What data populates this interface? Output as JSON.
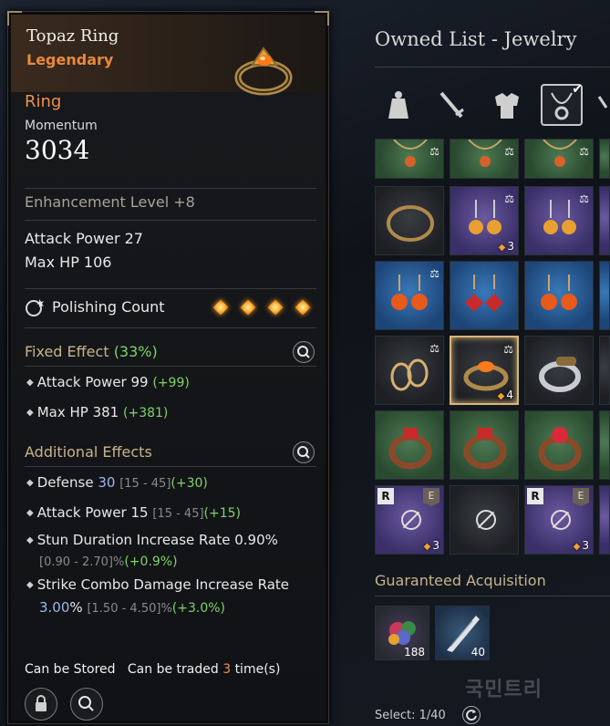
{
  "tooltip": {
    "item_name": "Topaz Ring",
    "grade": "Legendary",
    "type": "Ring",
    "momentum_label": "Momentum",
    "momentum_value": "3034",
    "enhancement": "Enhancement Level +8",
    "base_stats": [
      "Attack Power 27",
      "Max HP 106"
    ],
    "polishing_label": "Polishing Count",
    "polishing_count": 4,
    "fixed_effect": {
      "title": "Fixed Effect",
      "pct": "(33%)",
      "lines": [
        {
          "name": "Attack Power 99",
          "bonus": "(+99)"
        },
        {
          "name": "Max HP 381",
          "bonus": "(+381)"
        }
      ]
    },
    "additional_effects": {
      "title": "Additional Effects",
      "lines": [
        {
          "name": "Defense",
          "value": "30",
          "range": "[15 - 45]",
          "bonus": "(+30)"
        },
        {
          "name": "Attack Power 15",
          "range": "[15 - 45]",
          "bonus": "(+15)"
        },
        {
          "name": "Stun Duration Increase Rate 0.90%",
          "sub_range": "[0.90 - 2.70]%",
          "sub_bonus": "(+0.9%)"
        },
        {
          "name": "Strike Combo Damage Increase Rate",
          "sub_value": "3.00",
          "sub_unit": "%",
          "sub_range": "[1.50 - 4.50]%",
          "sub_bonus": "(+3.0%)"
        }
      ]
    },
    "footer": {
      "stored": "Can be Stored",
      "traded_pre": "Can be traded",
      "traded_count": "3",
      "traded_post": "time(s)"
    }
  },
  "panel": {
    "title": "Owned List - Jewelry",
    "categories": [
      "bag-icon",
      "sword-icon",
      "armor-icon",
      "jewelry-icon"
    ],
    "active_category": "jewelry-icon",
    "grid_counts": {
      "r1c2": "3",
      "r3c2": "4",
      "r5c1": "3",
      "r5c3": "3"
    },
    "grid_tags": {
      "R": "R",
      "E": "E"
    },
    "guaranteed_title": "Guaranteed Acquisition",
    "materials": [
      {
        "name": "gem-cluster-icon",
        "count": "188"
      },
      {
        "name": "feather-blade-icon",
        "count": "40"
      }
    ],
    "select_text": "Select: 1/40",
    "watermark": "국민트리"
  },
  "colors": {
    "grade": "#e88a3c",
    "bonus_green": "#7fd46a",
    "accent_gold": "#c9b48a",
    "highlight_blue": "#9ab8f0"
  }
}
